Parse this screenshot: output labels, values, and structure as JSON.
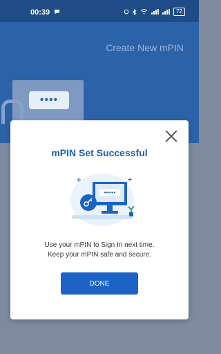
{
  "status": {
    "time": "00:39",
    "battery": "72"
  },
  "header": {
    "title": "Create New mPIN",
    "pin_mask": "••••"
  },
  "dialog": {
    "title": "mPIN Set Successful",
    "message_line1": "Use your mPIN to Sign In next time.",
    "message_line2": "Keep your mPIN safe and secure.",
    "illustration_pin": "••••••",
    "done_label": "DONE"
  },
  "colors": {
    "accent": "#1c63c6",
    "header": "#2b62a8",
    "statusbar": "#1f4c86"
  },
  "icons": [
    "notification-icon",
    "alarm-icon",
    "bluetooth-icon",
    "wifi-icon",
    "signal-icon",
    "battery-icon",
    "lock-icon",
    "close-icon",
    "key-icon",
    "monitor-icon",
    "plant-icon"
  ]
}
